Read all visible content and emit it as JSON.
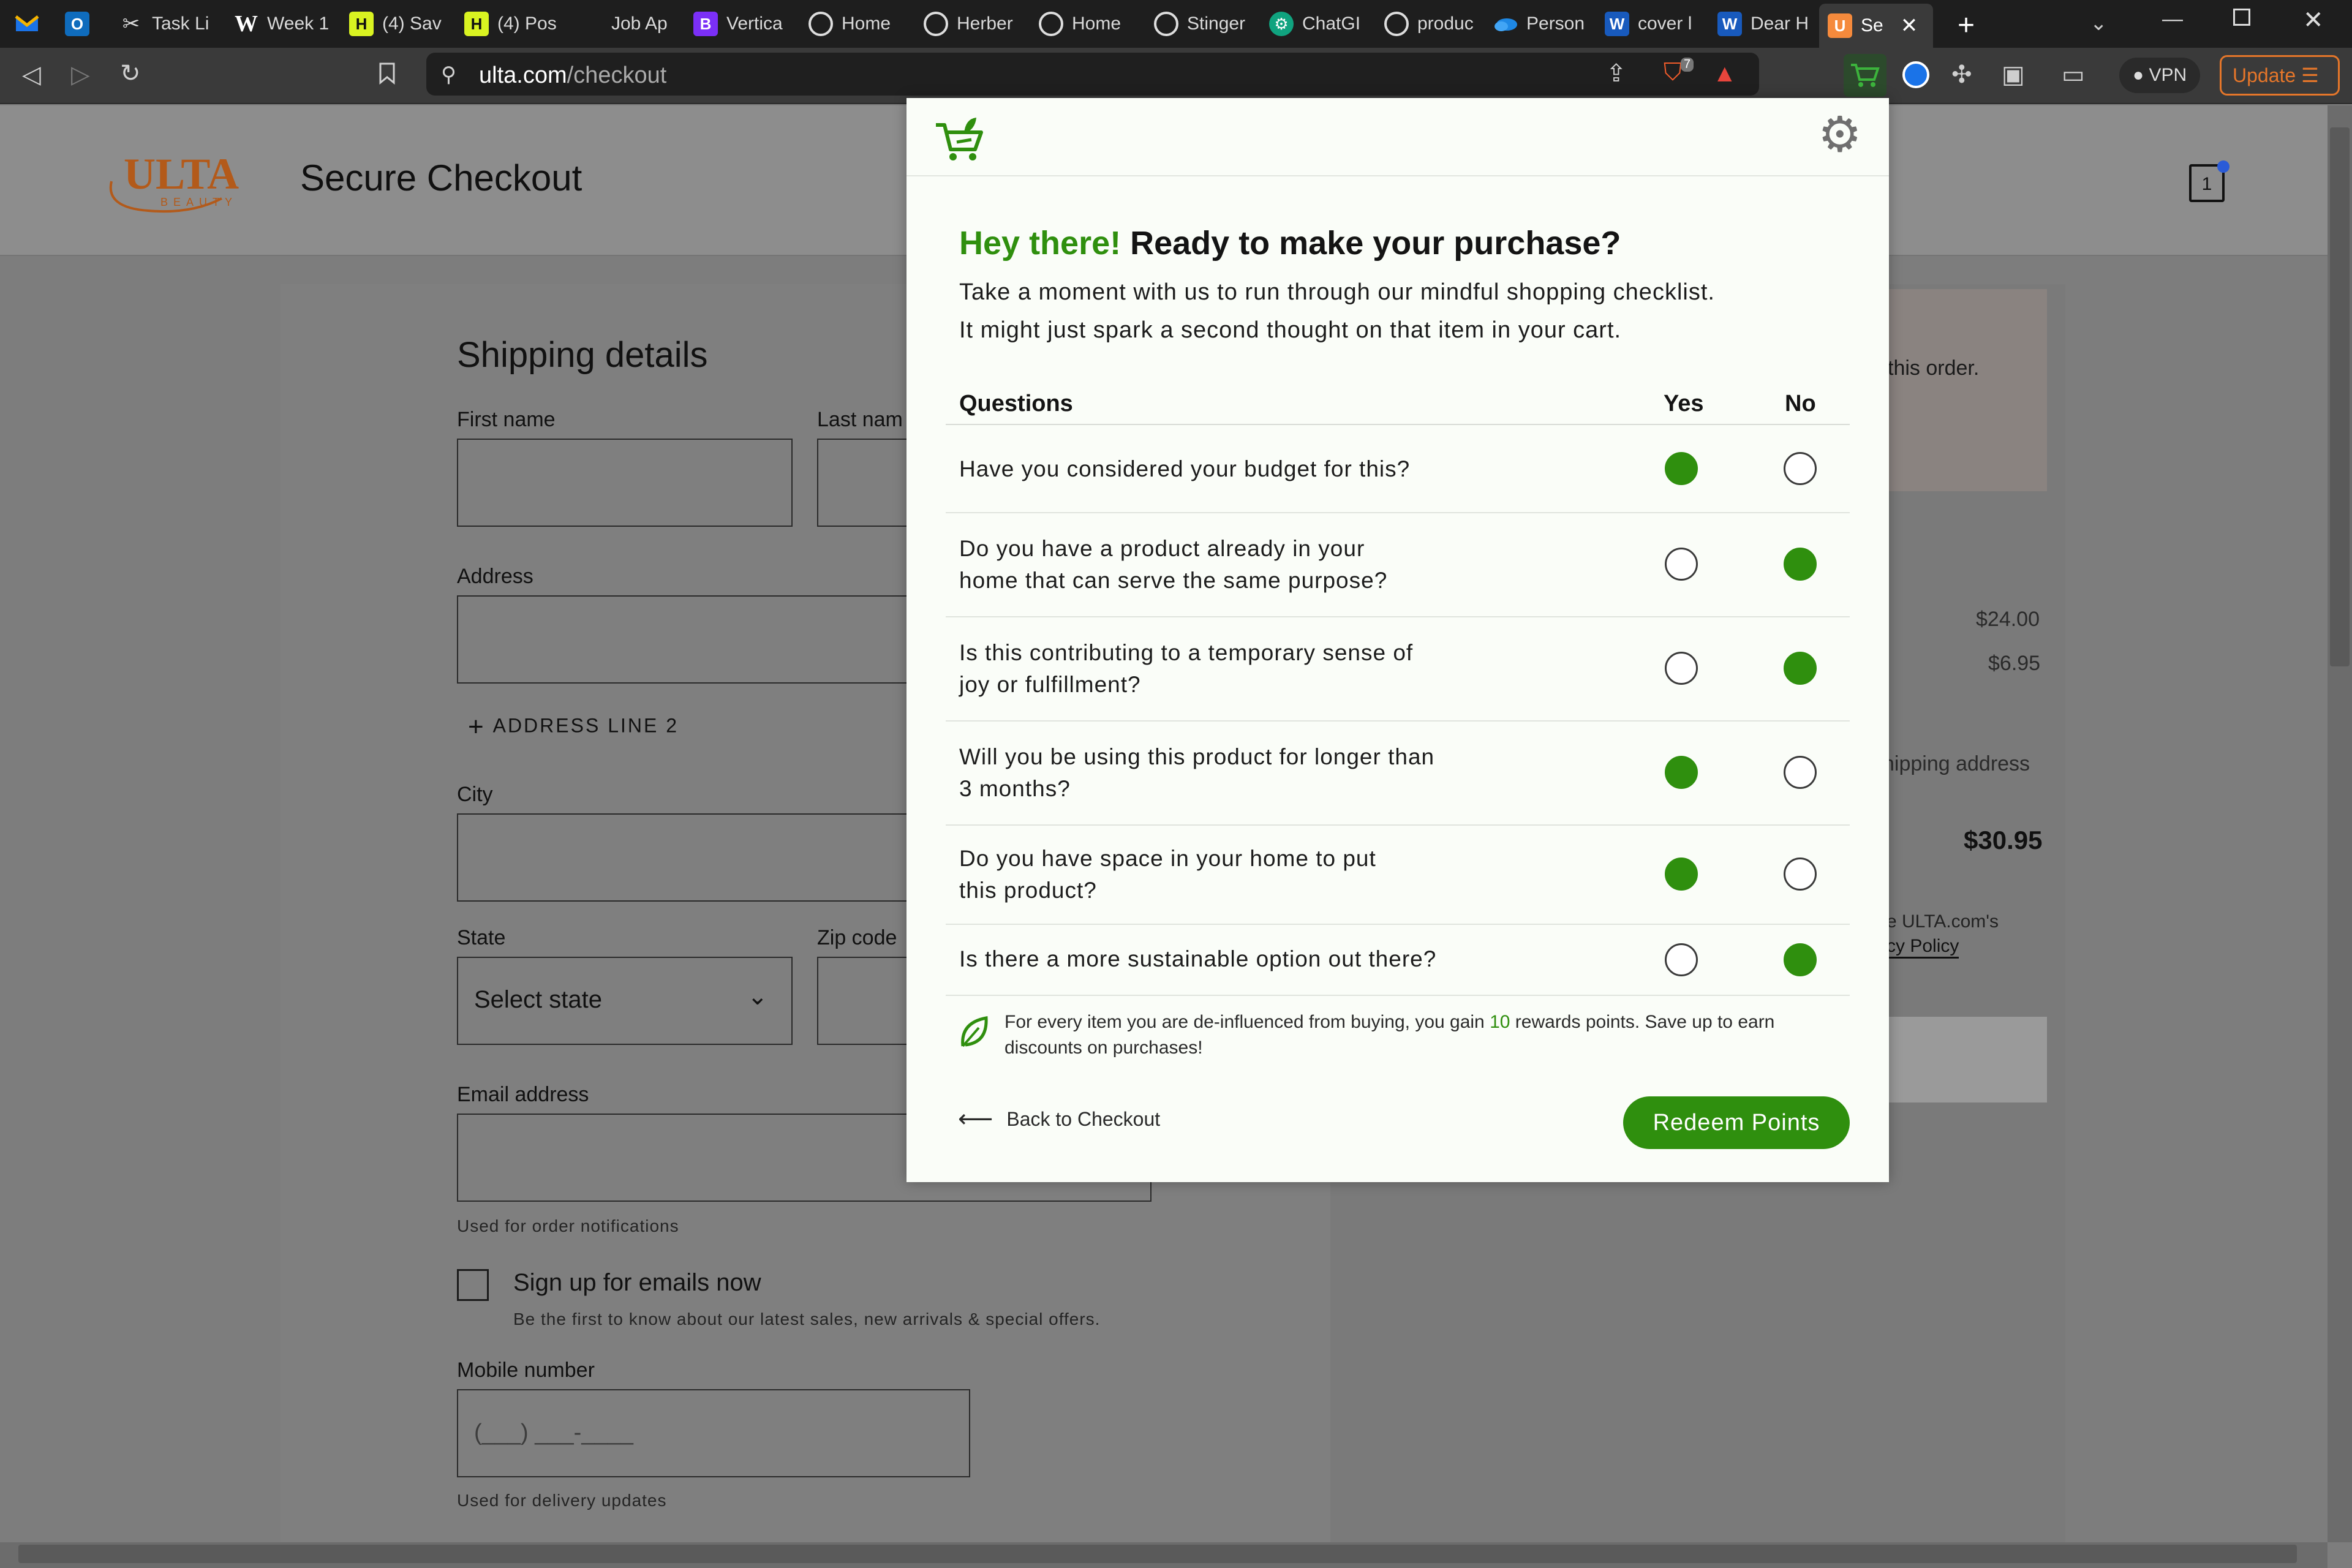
{
  "browser": {
    "tabs": [
      {
        "label": "",
        "icon": "mail-icon"
      },
      {
        "label": "",
        "icon": "outlook-icon"
      },
      {
        "label": "Task Li",
        "icon": "scissors-icon"
      },
      {
        "label": "Week 1",
        "icon": "wikipedia-icon"
      },
      {
        "label": "(4) Sav",
        "icon": "handshake-icon"
      },
      {
        "label": "(4) Pos",
        "icon": "handshake-icon"
      },
      {
        "label": "Job Ap",
        "icon": "blank-icon"
      },
      {
        "label": "Vertica",
        "icon": "bootstrap-icon"
      },
      {
        "label": "Home",
        "icon": "globe-icon"
      },
      {
        "label": "Herber",
        "icon": "globe-icon"
      },
      {
        "label": "Home",
        "icon": "globe-icon"
      },
      {
        "label": "Stinger",
        "icon": "globe-icon"
      },
      {
        "label": "ChatGI",
        "icon": "chatgpt-icon"
      },
      {
        "label": "produc",
        "icon": "globe-icon"
      },
      {
        "label": "Person",
        "icon": "onedrive-icon"
      },
      {
        "label": "cover l",
        "icon": "word-icon"
      },
      {
        "label": "Dear H",
        "icon": "word-icon"
      },
      {
        "label": "Se",
        "icon": "ulta-icon"
      }
    ],
    "url_host": "ulta.com",
    "url_path": "/checkout",
    "shield_count": "7",
    "vpn_label": "VPN",
    "update_label": "Update"
  },
  "page": {
    "logo_text": "ULTA",
    "logo_sub": "BEAUTY",
    "title": "Secure Checkout",
    "bag_count": "1",
    "shipping_title": "Shipping details",
    "first_name_label": "First name",
    "last_name_label": "Last nam",
    "address_label": "Address",
    "address_line2": "ADDRESS LINE 2",
    "city_label": "City",
    "state_label": "State",
    "state_value": "Select state",
    "zip_label": "Zip code",
    "email_label": "Email address",
    "email_hint": "Used for order notifications",
    "signup_label": "Sign up for emails now",
    "signup_hint": "Be the first to know about our latest sales, new arrivals & special offers.",
    "mobile_label": "Mobile number",
    "mobile_placeholder": "(___) ___-____",
    "mobile_hint": "Used for delivery updates",
    "summary": {
      "promo_fragment": "this order.",
      "subtotal": "$24.00",
      "shipping": "$6.95",
      "shipping_address_fragment": "hipping address",
      "total": "$30.95",
      "legal_line1": "e ULTA.com's",
      "legal_line2": "cy Policy"
    }
  },
  "modal": {
    "greeting_highlight": "Hey there!",
    "greeting_rest": "Ready to make your purchase?",
    "intro_line1": "Take a moment with us to run through our mindful shopping checklist.",
    "intro_line2": "It might just spark a second thought on that item in your cart.",
    "col_questions": "Questions",
    "col_yes": "Yes",
    "col_no": "No",
    "questions": [
      {
        "text": "Have you considered your budget for this?",
        "answer": "yes"
      },
      {
        "text": "Do you have a product already in your\nhome that can serve the same purpose?",
        "answer": "no"
      },
      {
        "text": "Is this contributing to a temporary sense of\njoy or fulfillment?",
        "answer": "no"
      },
      {
        "text": "Will you be using this product for longer than\n3 months?",
        "answer": "yes"
      },
      {
        "text": "Do you have space in your home to put\nthis product?",
        "answer": "yes"
      },
      {
        "text": "Is there a more sustainable option out there?",
        "answer": "no"
      }
    ],
    "rewards_before": "For every item you are de-influenced from buying, you gain ",
    "rewards_points": "10",
    "rewards_after": " rewards points. Save up to earn discounts on purchases!",
    "back_label": "Back to Checkout",
    "redeem_label": "Redeem Points",
    "accent_color": "#2f8f0e"
  }
}
